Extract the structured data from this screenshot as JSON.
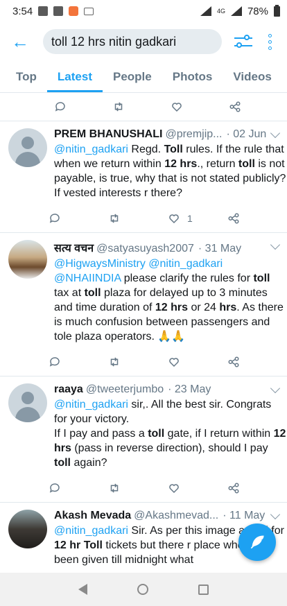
{
  "status_bar": {
    "time": "3:54",
    "network": "4G",
    "battery": "78%"
  },
  "search": {
    "query": "toll 12 hrs nitin gadkari"
  },
  "tabs": [
    {
      "label": "Top"
    },
    {
      "label": "Latest"
    },
    {
      "label": "People"
    },
    {
      "label": "Photos"
    },
    {
      "label": "Videos"
    }
  ],
  "tweets": [
    {
      "name": "PREM BHANUSHALI",
      "handle": "@premjip...",
      "date": "· 02 Jun",
      "likes": "1",
      "text": [
        {
          "t": "@nitin_gadkari",
          "s": "mention"
        },
        {
          "t": " "
        },
        {
          "t": "Regd. "
        },
        {
          "t": "Toll",
          "s": "bold"
        },
        {
          "t": " rules. If the rule that when we return within "
        },
        {
          "t": "12 hrs",
          "s": "bold"
        },
        {
          "t": "., return "
        },
        {
          "t": "toll",
          "s": "bold"
        },
        {
          "t": " is not payable, is true, why that is not stated publicly? If vested interests r there?"
        }
      ]
    },
    {
      "name": "सत्य वचन",
      "handle": "@satyasuyash2007",
      "date": "· 31 May",
      "likes": "",
      "text": [
        {
          "t": "@HigwaysMinistry",
          "s": "mention"
        },
        {
          "t": " "
        },
        {
          "t": "@nitin_gadkari",
          "s": "mention"
        },
        {
          "t": " "
        },
        {
          "t": "@NHAIINDIA",
          "s": "mention"
        },
        {
          "t": " please clarify the rules for "
        },
        {
          "t": "toll",
          "s": "bold"
        },
        {
          "t": " tax at "
        },
        {
          "t": "toll",
          "s": "bold"
        },
        {
          "t": " plaza for delayed up to 3 minutes and time duration of "
        },
        {
          "t": "12 hrs",
          "s": "bold"
        },
        {
          "t": " or 24 "
        },
        {
          "t": "hrs",
          "s": "bold"
        },
        {
          "t": ". As there is much confusion between passengers and tole plaza operators. 🙏🙏"
        }
      ]
    },
    {
      "name": "raaya",
      "handle": "@tweeterjumbo",
      "date": "· 23 May",
      "likes": "",
      "text": [
        {
          "t": "@nitin_gadkari",
          "s": "mention"
        },
        {
          "t": " sir,.  All the best sir.  Congrats for your victory."
        },
        {
          "t": "\n"
        },
        {
          "t": "If I pay and pass a "
        },
        {
          "t": "toll",
          "s": "bold"
        },
        {
          "t": " gate, if I return within "
        },
        {
          "t": "12 hrs",
          "s": "bold"
        },
        {
          "t": " (pass in reverse direction), should I pay "
        },
        {
          "t": "toll",
          "s": "bold"
        },
        {
          "t": " again?"
        }
      ]
    },
    {
      "name": "Akash Mevada",
      "handle": "@Akashmevad...",
      "date": "· 11 May",
      "likes": "",
      "text": [
        {
          "t": "@nitin_gadkari",
          "s": "mention"
        },
        {
          "t": " Sir. As per this image asked for "
        },
        {
          "t": "12 hr Toll",
          "s": "bold"
        },
        {
          "t": " tickets but there r place where its been given till midnight what"
        }
      ]
    }
  ],
  "colors": {
    "accent": "#1da1f2",
    "muted": "#657786",
    "divider": "#e1e8ed"
  }
}
